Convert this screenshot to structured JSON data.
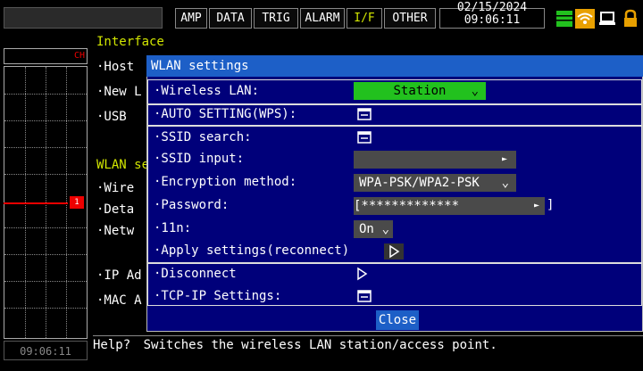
{
  "tabs": [
    "AMP",
    "DATA",
    "TRIG",
    "ALARM",
    "I/F",
    "OTHER"
  ],
  "active_tab": "I/F",
  "datetime": {
    "date": "02/15/2024",
    "time": "09:06:11"
  },
  "status_icons": [
    "battery-icon",
    "wifi-icon",
    "device-icon",
    "lock-icon"
  ],
  "left_panel": {
    "channel_label": "CH",
    "channel_marker": "1",
    "clock": "09:06:11"
  },
  "background": {
    "heading": "Interface",
    "items": [
      "·Host",
      "·New L",
      "·USB",
      "WLAN se",
      "·Wire",
      "·Deta",
      "·Netw",
      "·IP Ad",
      "·MAC A"
    ]
  },
  "dialog": {
    "title": "WLAN settings",
    "rows": [
      {
        "label": "·Wireless LAN:",
        "control": "dropdown",
        "value": "Station"
      },
      {
        "label": "·AUTO SETTING(WPS):",
        "control": "button"
      },
      {
        "label": "·SSID search:",
        "control": "button"
      },
      {
        "label": "·SSID input:",
        "control": "dropdown",
        "value": ""
      },
      {
        "label": "·Encryption method:",
        "control": "dropdown",
        "value": "WPA-PSK/WPA2-PSK"
      },
      {
        "label": "·Password:",
        "control": "input",
        "value": "[*************"
      },
      {
        "label": "·11n:",
        "control": "dropdown",
        "value": "On"
      },
      {
        "label": "·Apply settings(reconnect)",
        "control": "play"
      },
      {
        "label": "·Disconnect",
        "control": "play"
      },
      {
        "label": "·TCP-IP Settings:",
        "control": "button"
      }
    ],
    "close_label": "Close"
  },
  "help": {
    "prefix": "Help?",
    "text": "Switches the wireless LAN station/access point."
  },
  "colors": {
    "accent_green": "#22c11e",
    "dialog_bg": "#00007a",
    "title_blue": "#1d5fc7",
    "highlight_yellow": "#d2e600",
    "channel_red": "#e00000"
  }
}
